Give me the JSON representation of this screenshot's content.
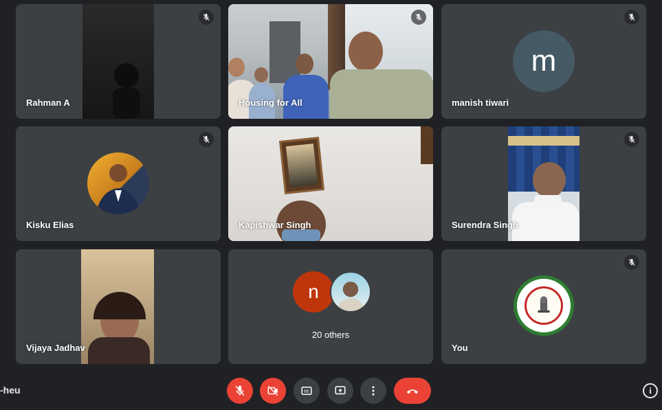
{
  "participants": [
    {
      "name": "Rahman A",
      "muted": true
    },
    {
      "name": "Housing for All",
      "muted": true
    },
    {
      "name": "manish tiwari",
      "muted": true,
      "avatar_letter": "m",
      "avatar_color": "#455a64"
    },
    {
      "name": "Kisku Elias",
      "muted": true
    },
    {
      "name": "Kapishwar Singh",
      "muted": false
    },
    {
      "name": "Surendra Singh",
      "muted": true
    },
    {
      "name": "Vijaya Jadhav",
      "muted": false
    },
    {
      "name": "You",
      "muted": true
    }
  ],
  "others": {
    "label": "20 others",
    "avatar_letter": "n",
    "avatar_color": "#bf360c"
  },
  "meeting_code_fragment": "-heu",
  "controls": {
    "mic": "mic-off-icon",
    "camera": "camera-off-icon",
    "captions": "captions-icon",
    "present": "present-screen-icon",
    "more": "more-options-icon",
    "leave": "leave-call-icon",
    "info": "i"
  },
  "colors": {
    "background": "#202124",
    "tile": "#3c4043",
    "danger": "#ea4335"
  }
}
